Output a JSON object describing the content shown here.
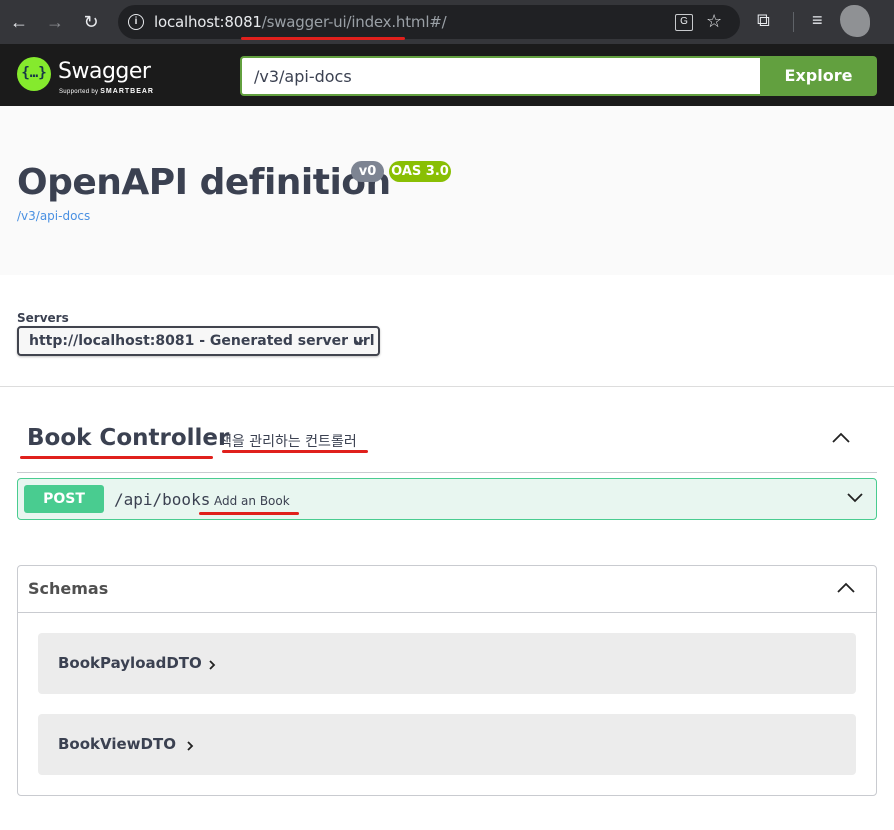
{
  "browser": {
    "url_host": "localhost:8081",
    "url_path": "/swagger-ui/index.html#/",
    "translate_label": "G"
  },
  "topbar": {
    "logo_glyph": "{…}",
    "logo_text": "Swagger",
    "logo_sub_prefix": "Supported by ",
    "logo_sub_brand": "SMARTBEAR",
    "url_value": "/v3/api-docs",
    "explore_label": "Explore"
  },
  "info": {
    "title": "OpenAPI definition",
    "version": "v0",
    "oas": "OAS 3.0",
    "link": "/v3/api-docs"
  },
  "servers": {
    "label": "Servers",
    "selected": "http://localhost:8081 - Generated server url"
  },
  "tag": {
    "name": "Book Controller",
    "description": "책을 관리하는 컨트롤러"
  },
  "operation": {
    "method": "POST",
    "path": "/api/books",
    "summary": "Add an Book"
  },
  "schemas": {
    "title": "Schemas",
    "items": [
      {
        "name": "BookPayloadDTO"
      },
      {
        "name": "BookViewDTO"
      }
    ]
  },
  "colors": {
    "post": "#49cc90",
    "swagger_green": "#85ea2d",
    "explore": "#62a03f",
    "annotation": "#e0201c"
  }
}
